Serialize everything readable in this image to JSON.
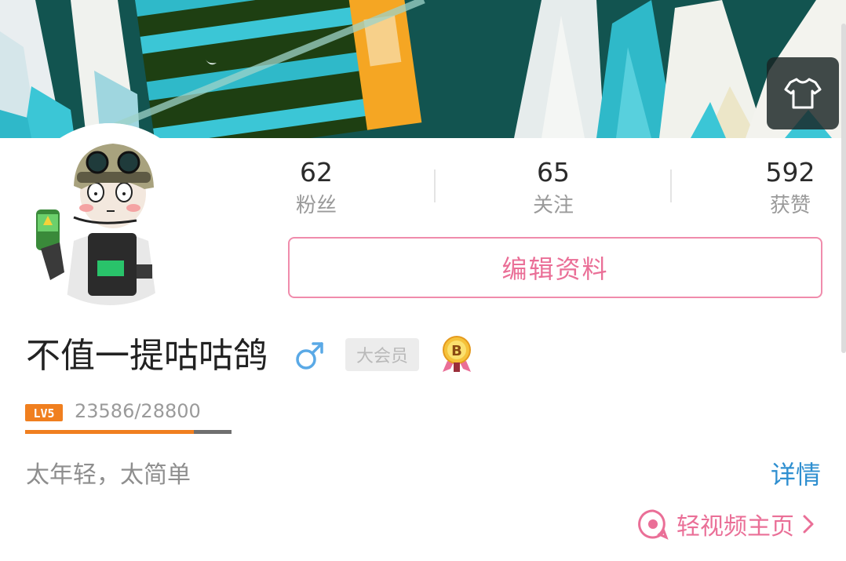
{
  "header": {
    "skin_button_icon": "tshirt-icon"
  },
  "profile": {
    "username": "不值一提咕咕鸽",
    "gender_icon": "male-icon",
    "vip_badge": "大会员",
    "medal_icon": "bilibili-medal-icon",
    "level_icon": "level-5-icon",
    "level_label": "LV5",
    "experience_text": "23586/28800",
    "experience_progress": 0.819,
    "signature": "太年轻，太简单"
  },
  "stats": {
    "fans": {
      "count": "62",
      "label": "粉丝"
    },
    "following": {
      "count": "65",
      "label": "关注"
    },
    "likes": {
      "count": "592",
      "label": "获赞"
    }
  },
  "actions": {
    "edit_profile": "编辑资料",
    "details": "详情",
    "video_home": "轻视频主页"
  },
  "colors": {
    "accent_pink": "#ea6f97",
    "link_blue": "#2f8fd0",
    "level_orange": "#f07f1f",
    "gender_blue": "#5aa9e6",
    "banner_teal": "#155a55"
  }
}
